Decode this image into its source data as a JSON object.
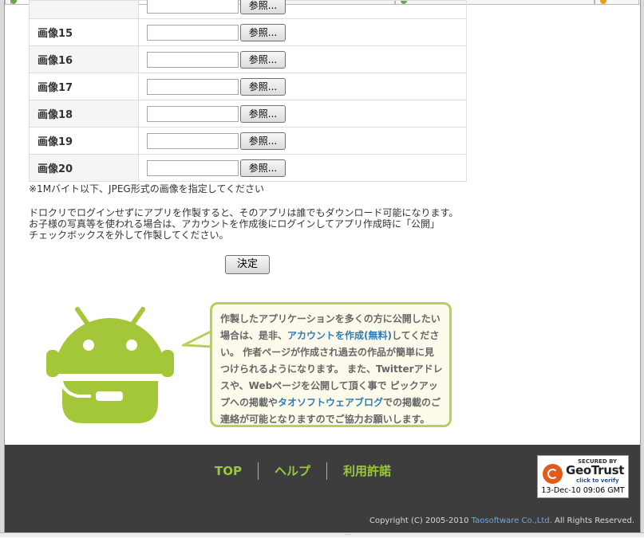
{
  "form": {
    "rows": [
      {
        "label": "",
        "browse_label": "参照..."
      },
      {
        "label": "画像15",
        "browse_label": "参照..."
      },
      {
        "label": "画像16",
        "browse_label": "参照..."
      },
      {
        "label": "画像17",
        "browse_label": "参照..."
      },
      {
        "label": "画像18",
        "browse_label": "参照..."
      },
      {
        "label": "画像19",
        "browse_label": "参照..."
      },
      {
        "label": "画像20",
        "browse_label": "参照..."
      }
    ],
    "size_note": "※1Mバイト以下、JPEG形式の画像を指定してください",
    "warning_lines": [
      "ドロクリでログインせずにアプリを作製すると、そのアプリは誰でもダウンロード可能になります。",
      "お子様の写真等を使われる場合は、アカウントを作成後にログインしてアプリ作成時に「公開」",
      "チェックボックスを外して作製してください。"
    ],
    "submit_label": "決定"
  },
  "promo": {
    "text_1": "作製したアプリケーションを多くの方に公開したい場合は、是非、",
    "link_account": "アカウントを作成(無料)",
    "text_2": "してください。 作者ページが作成され過去の作品が簡単に見つけられるようになります。 また、Twitterアドレスや、Webページを公開して頂く事で ピックアップへの掲載や",
    "link_blog": "タオソフトウェアブログ",
    "text_3": "での掲載のご連絡が可能となりますのでご協力お願いします。"
  },
  "footer": {
    "nav": [
      "TOP",
      "ヘルプ",
      "利用許諾"
    ],
    "copyright_prefix": "Copyright (C) 2005-2010 ",
    "copyright_link": "Taosoftware Co.,Ltd.",
    "copyright_suffix": " All Rights Reserved.",
    "badge": {
      "secured_by": "SECURED BY",
      "brand": "GeoTrust",
      "verify": "click to verify",
      "timestamp": "13-Dec-10 09:06 GMT"
    }
  },
  "colors": {
    "accent_green": "#99c83c",
    "mascot_green": "#a4c639",
    "link_blue": "#2f7bb6",
    "footer_bg": "#3d3d3d"
  },
  "icons": [
    "android-mascot-icon",
    "geotrust-logo-icon"
  ]
}
